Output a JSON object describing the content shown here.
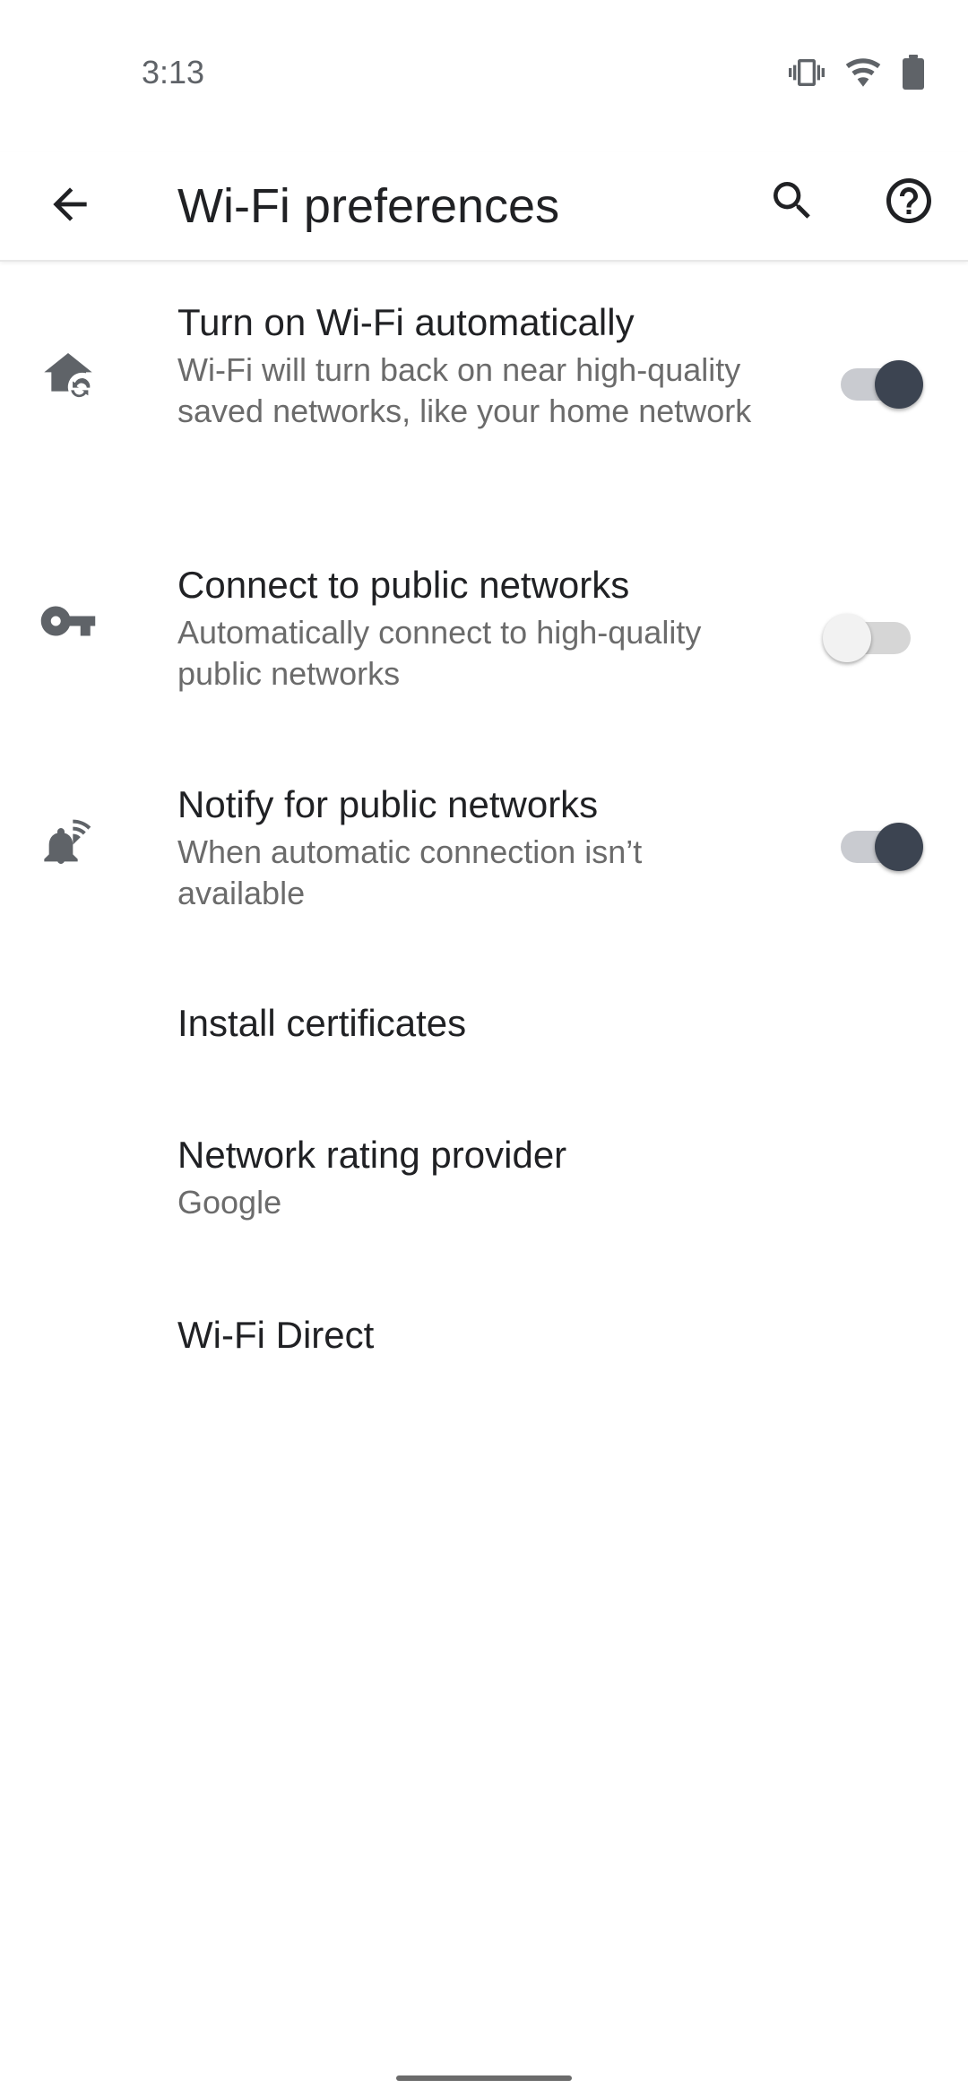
{
  "status_bar": {
    "time": "3:13",
    "icons": [
      "vibrate-icon",
      "wifi-icon",
      "battery-icon"
    ]
  },
  "app_bar": {
    "title": "Wi-Fi preferences",
    "back_icon": "arrow-back-icon",
    "search_icon": "search-icon",
    "help_icon": "help-circle-icon"
  },
  "preferences": [
    {
      "id": "turn-on-wifi-automatically",
      "icon": "home-sync-icon",
      "title": "Turn on Wi-Fi automatically",
      "summary": "Wi-Fi will turn back on near high-quality saved networks, like your home network",
      "switch_on": true
    },
    {
      "id": "connect-to-public-networks",
      "icon": "key-icon",
      "title": "Connect to public networks",
      "summary": "Automatically connect to high-quality public networks",
      "switch_on": false
    },
    {
      "id": "notify-for-public-networks",
      "icon": "wifi-notification-bell-icon",
      "title": "Notify for public networks",
      "summary": "When automatic connection isn’t available",
      "switch_on": true
    },
    {
      "id": "install-certificates",
      "title": "Install certificates"
    },
    {
      "id": "network-rating-provider",
      "title": "Network rating provider",
      "summary": "Google"
    },
    {
      "id": "wifi-direct",
      "title": "Wi-Fi Direct"
    }
  ],
  "colors": {
    "switch_thumb_on": "#3c4451",
    "switch_track_on": "#c9cbd0",
    "switch_thumb_off": "#f2f2f2",
    "icon_gray": "#5f6368",
    "summary_gray": "#6b6b6b"
  }
}
